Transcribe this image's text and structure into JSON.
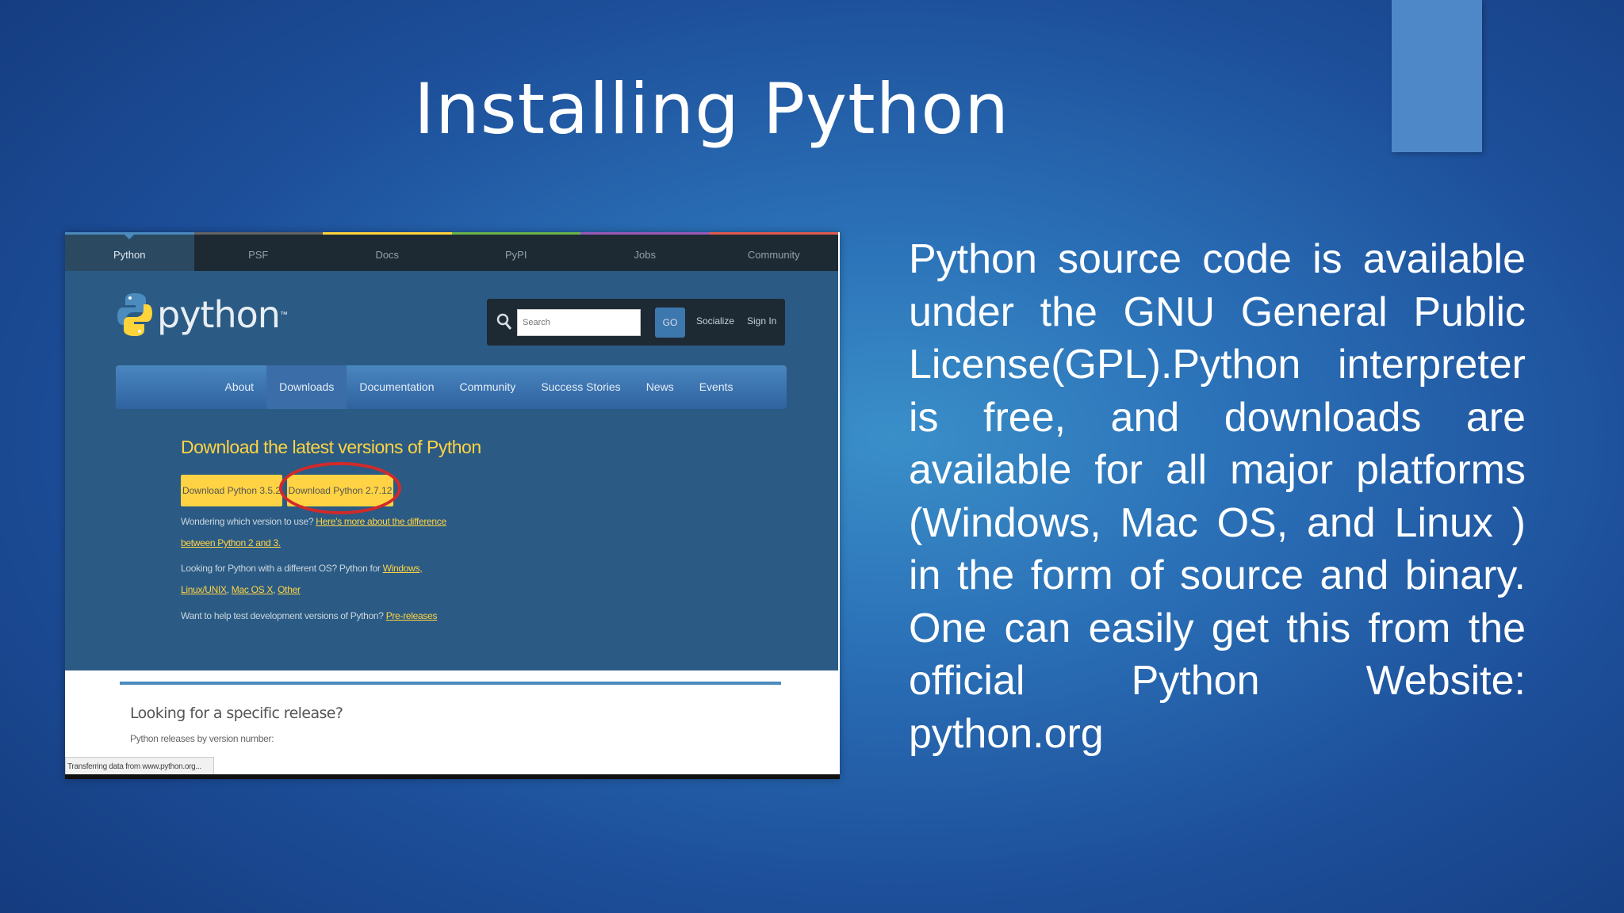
{
  "slide": {
    "title": "Installing Python",
    "body": "Python source code is available under the GNU General Public License(GPL).Python interpreter is free, and downloads are available for all major platforms (Windows, Mac OS, and Linux ) in the form of source and binary. One can easily get this from the official Python Website: python.org"
  },
  "screenshot": {
    "top_tabs": [
      "Python",
      "PSF",
      "Docs",
      "PyPI",
      "Jobs",
      "Community"
    ],
    "logo_text": "python",
    "logo_tm": "™",
    "search_placeholder": "Search",
    "go_label": "GO",
    "socialize_label": "Socialize",
    "signin_label": "Sign In",
    "main_nav": [
      "About",
      "Downloads",
      "Documentation",
      "Community",
      "Success Stories",
      "News",
      "Events"
    ],
    "download_heading": "Download the latest versions of Python",
    "btn_py3": "Download Python 3.5.2",
    "btn_py2": "Download Python 2.7.12",
    "which_version_text": "Wondering which version to use? ",
    "which_version_link": "Here's more about the difference",
    "which_version_link2": "between Python 2 and 3.",
    "other_os_text": "Looking for Python with a different OS? Python for ",
    "other_os_windows": "Windows,",
    "other_os_linux": "Linux/UNIX",
    "other_os_sep1": ", ",
    "other_os_mac": "Mac OS X",
    "other_os_sep2": ", ",
    "other_os_other": "Other",
    "prerelease_text": "Want to help test development versions of Python? ",
    "prerelease_link": "Pre-releases",
    "lower_heading": "Looking for a specific release?",
    "lower_sub": "Python releases by version number:",
    "status_text": "Transferring data from www.python.org..."
  }
}
